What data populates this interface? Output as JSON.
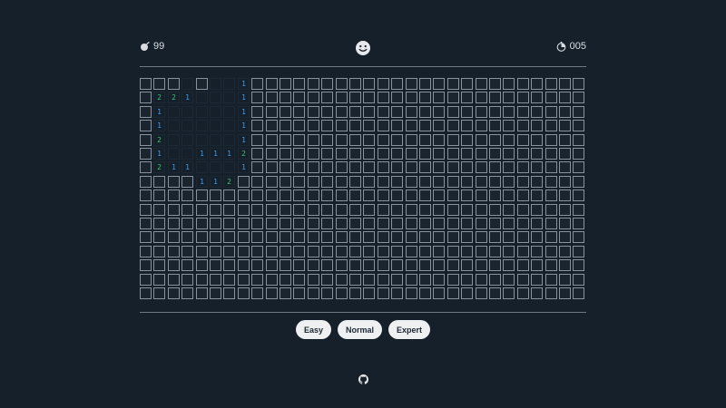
{
  "header": {
    "mines_remaining": "99",
    "timer": "005",
    "mine_icon": "bomb-icon",
    "timer_icon": "stopwatch-icon",
    "reset_icon": "smiley-face-icon"
  },
  "board": {
    "rows": 16,
    "cols": 32,
    "revealed": [
      "...0.001",
      ".2210001",
      ".1000001",
      ".1000001",
      ".2000001",
      ".1001112",
      ".2110001.",
      "....112"
    ]
  },
  "difficulty": {
    "buttons": [
      "Easy",
      "Normal",
      "Expert"
    ]
  },
  "footer": {
    "icon": "github-icon"
  },
  "colors": {
    "background": "#15202b",
    "number_1": "#3d9cf0",
    "number_2": "#3cc473",
    "cell_border": "#8a939d"
  }
}
